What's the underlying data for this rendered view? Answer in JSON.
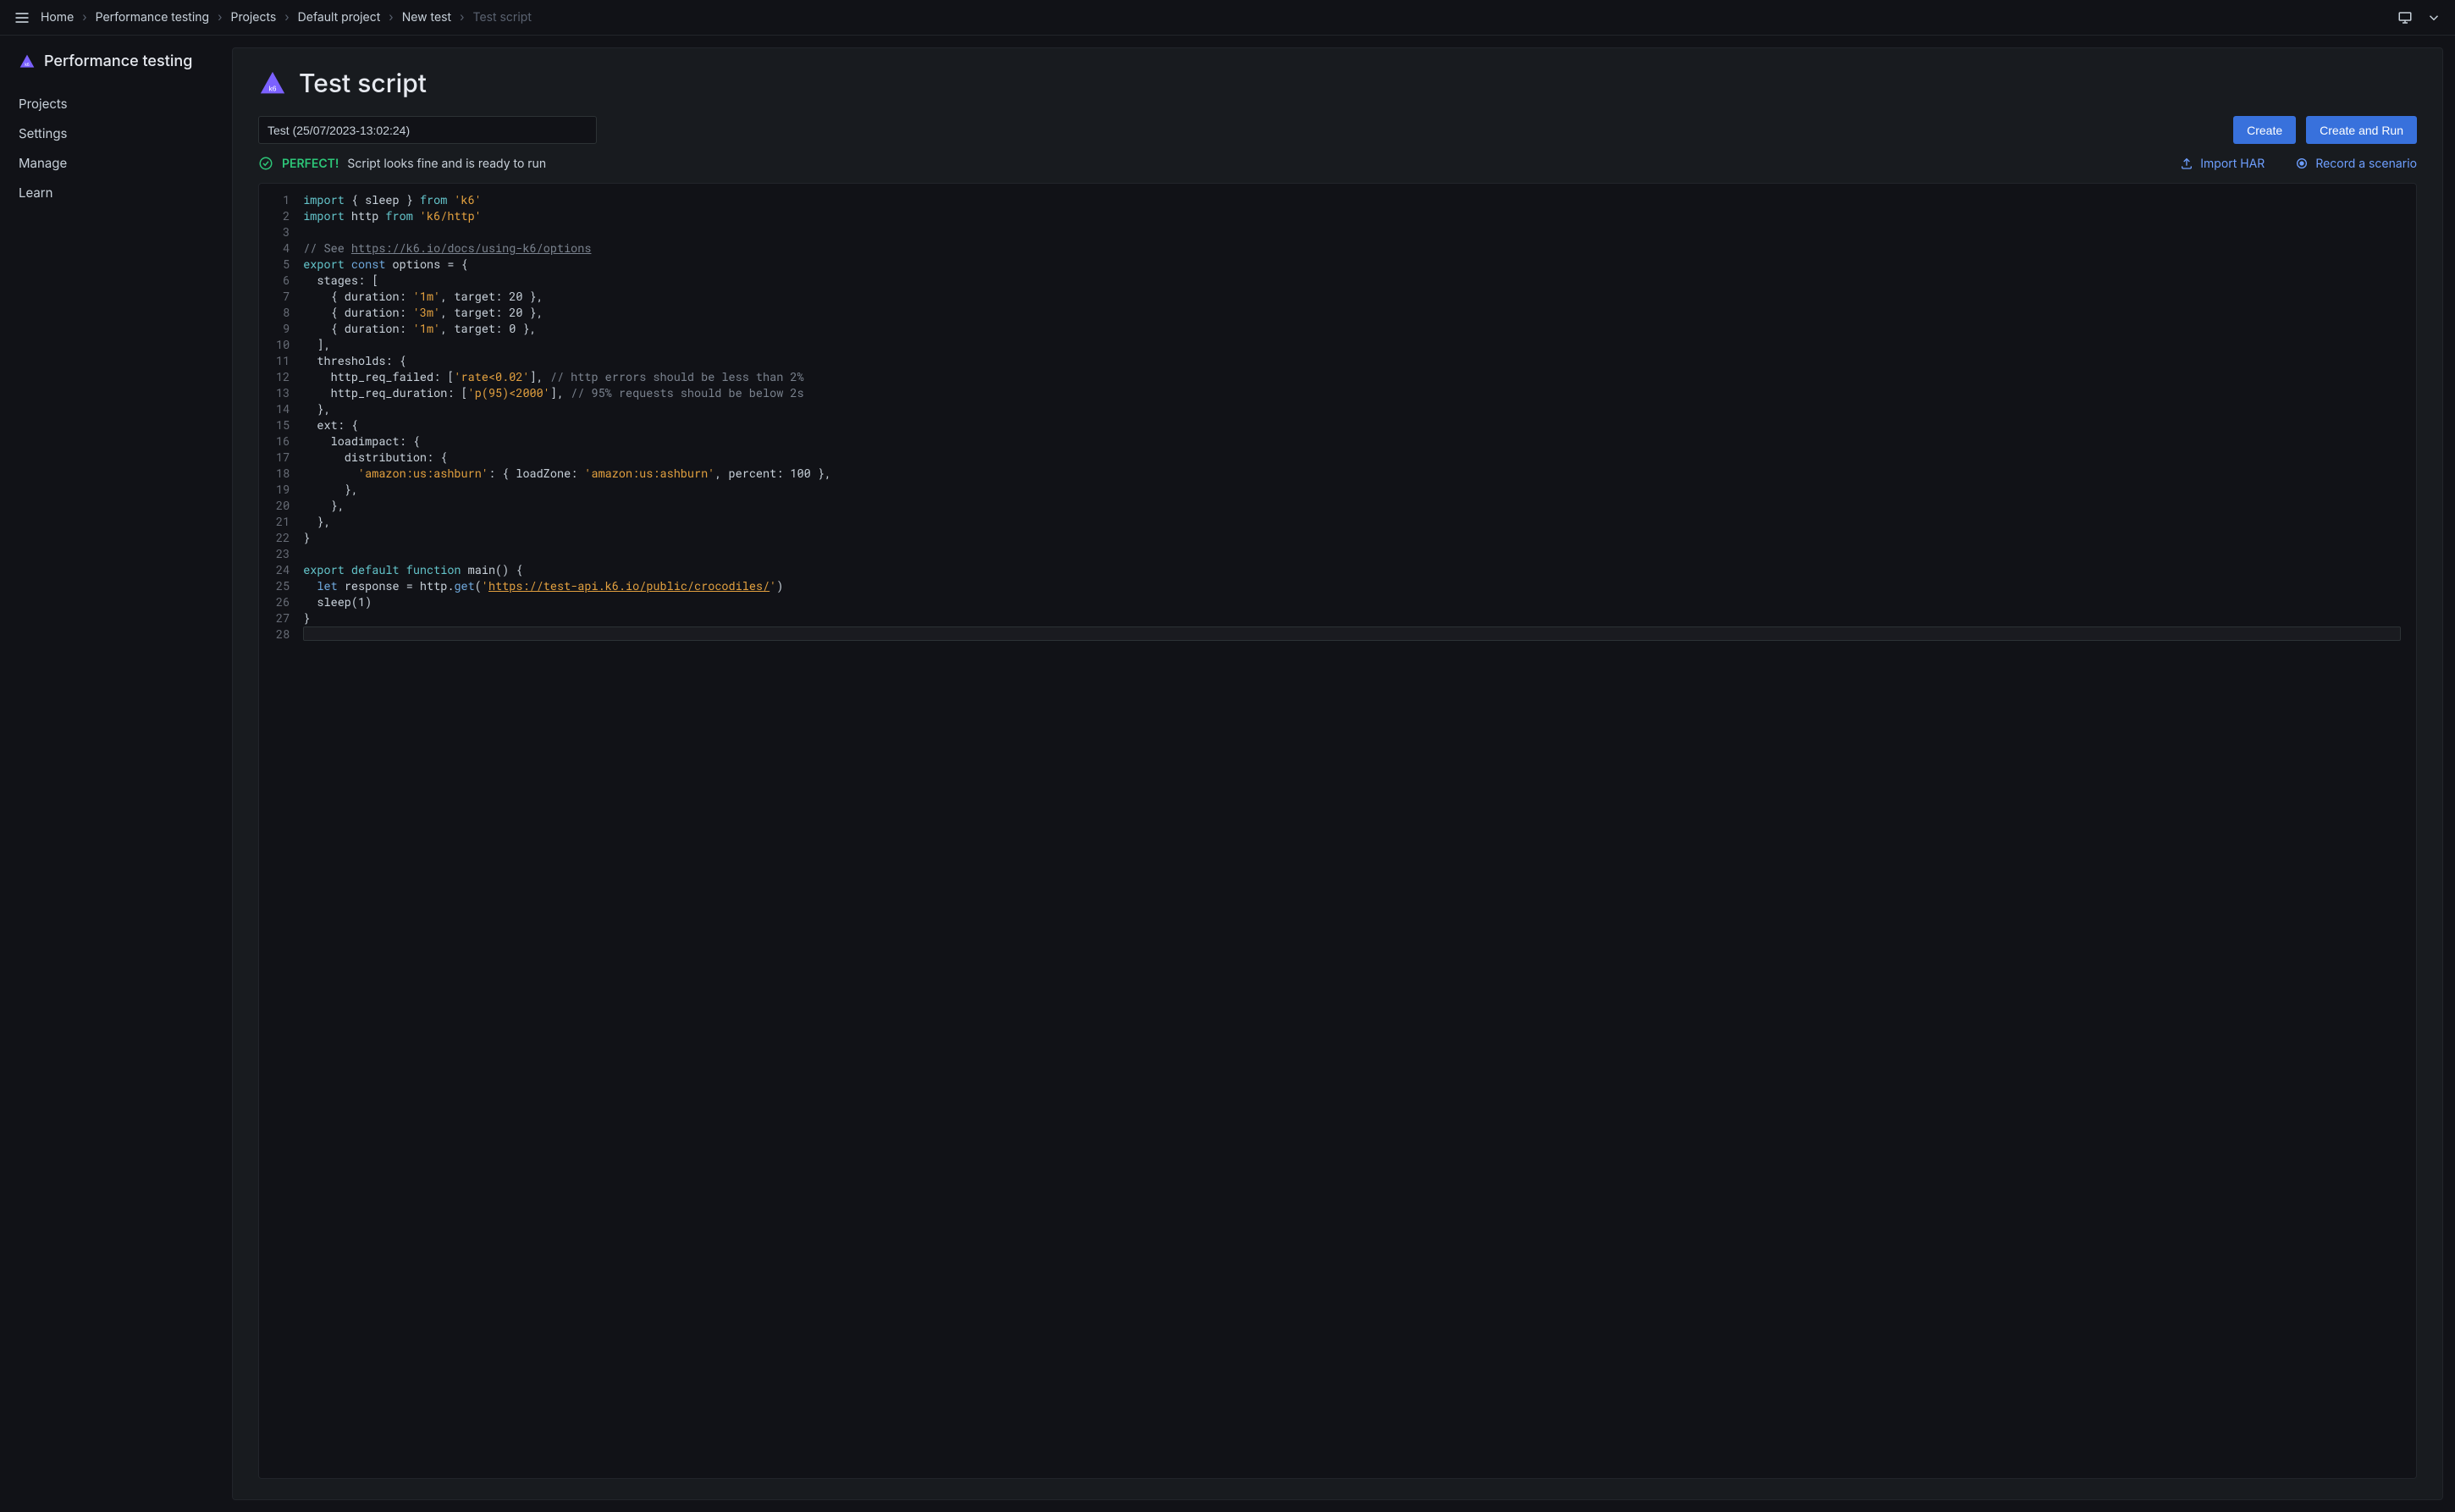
{
  "breadcrumbs": {
    "items": [
      "Home",
      "Performance testing",
      "Projects",
      "Default project",
      "New test",
      "Test script"
    ]
  },
  "sidebar": {
    "title": "Performance testing",
    "items": [
      "Projects",
      "Settings",
      "Manage",
      "Learn"
    ]
  },
  "page": {
    "title": "Test script"
  },
  "input": {
    "test_name": "Test (25/07/2023-13:02:24)"
  },
  "buttons": {
    "create": "Create",
    "create_and_run": "Create and Run"
  },
  "status": {
    "perfect": "PERFECT!",
    "msg": "Script looks fine and is ready to run"
  },
  "actions": {
    "import_har": "Import HAR",
    "record_scenario": "Record a scenario"
  },
  "code": {
    "total_lines": 28,
    "links": {
      "options_doc": "https://k6.io/docs/using-k6/options",
      "test_api": "https://test-api.k6.io/public/crocodiles/"
    },
    "lines": {
      "l1_kw_import": "import",
      "l1_rest1": " { sleep } ",
      "l1_kw_from": "from",
      "l1_str": " 'k6'",
      "l2_kw_import": "import",
      "l2_rest1": " http ",
      "l2_kw_from": "from",
      "l2_str": " 'k6/http'",
      "l4_cm": "// See ",
      "l5_export": "export ",
      "l5_const": "const",
      "l5_rest": " options = {",
      "l6": "  stages: [",
      "l7a": "    { duration: ",
      "l7s": "'1m'",
      "l7b": ", target: 20 },",
      "l8a": "    { duration: ",
      "l8s": "'3m'",
      "l8b": ", target: 20 },",
      "l9a": "    { duration: ",
      "l9s": "'1m'",
      "l9b": ", target: 0 },",
      "l10": "  ],",
      "l11": "  thresholds: {",
      "l12a": "    http_req_failed: [",
      "l12s": "'rate<0.02'",
      "l12b": "], ",
      "l12cm": "// http errors should be less than 2%",
      "l13a": "    http_req_duration: [",
      "l13s": "'p(95)<2000'",
      "l13b": "], ",
      "l13cm": "// 95% requests should be below 2s",
      "l14": "  },",
      "l15": "  ext: {",
      "l16": "    loadimpact: {",
      "l17": "      distribution: {",
      "l18a": "        ",
      "l18s1": "'amazon:us:ashburn'",
      "l18b": ": { loadZone: ",
      "l18s2": "'amazon:us:ashburn'",
      "l18c": ", percent: 100 },",
      "l19": "      },",
      "l20": "    },",
      "l21": "  },",
      "l22": "}",
      "l24a": "export default function",
      "l24b": " main() {",
      "l25a": "  ",
      "l25let": "let",
      "l25b": " response = http.",
      "l25fn": "get",
      "l25c": "(",
      "l25s": "'",
      "l25url": "",
      "l25s2": "'",
      "l25d": ")",
      "l26": "  sleep(1)",
      "l27": "}"
    }
  }
}
